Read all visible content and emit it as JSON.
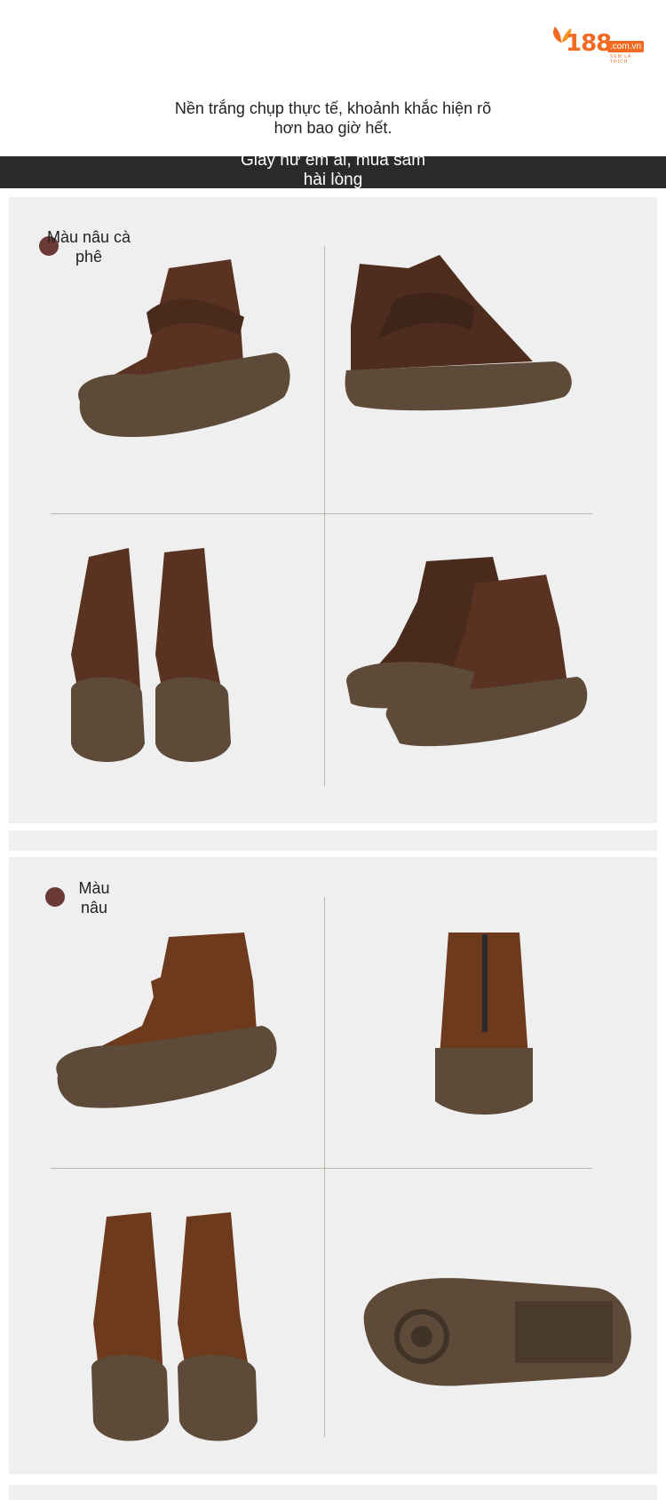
{
  "logo": {
    "number": "188",
    "domain": ".com.vn",
    "tagline": "XEM LÀ THÍCH"
  },
  "caption": {
    "line1": "Nền trắng chụp thực tế, khoảnh khắc hiện rõ",
    "line2": "hơn bao giờ hết."
  },
  "banner": {
    "line1": "Giầy nữ êm ái, mua sắm",
    "line2": "hài lòng"
  },
  "variants": [
    {
      "label_line1": "Màu nâu cà",
      "label_line2": "phê",
      "swatch_color": "#6b3a36",
      "leather_color": "#5a3222"
    },
    {
      "label_line1": "Màu",
      "label_line2": "nâu",
      "swatch_color": "#6b3a36",
      "leather_color": "#6e3a1e"
    }
  ],
  "colors": {
    "sole": "#5e4a38",
    "panel": "#efefef",
    "banner": "#2a2a2a",
    "brand": "#f26a21"
  }
}
